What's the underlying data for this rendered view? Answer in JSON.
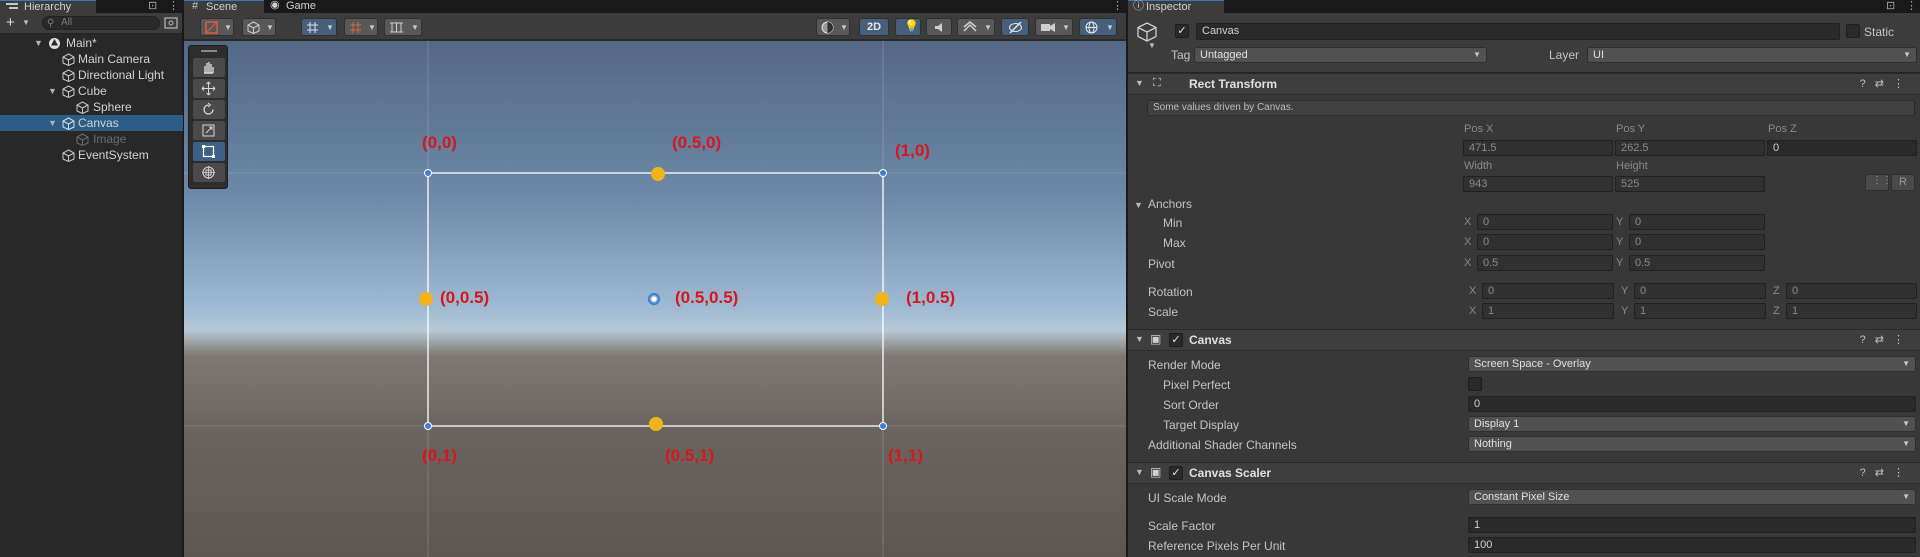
{
  "hierarchy": {
    "tab_label": "Hierarchy",
    "add_label": "+",
    "search_placeholder": "All",
    "items": [
      {
        "label": "Main*",
        "icon": "unity-scene-icon"
      },
      {
        "label": "Main Camera",
        "icon": "cube-icon"
      },
      {
        "label": "Directional Light",
        "icon": "cube-icon"
      },
      {
        "label": "Cube",
        "icon": "cube-icon"
      },
      {
        "label": "Sphere",
        "icon": "cube-icon"
      },
      {
        "label": "Canvas",
        "icon": "cube-icon",
        "selected": true
      },
      {
        "label": "Image",
        "icon": "cube-icon",
        "disabled": true
      },
      {
        "label": "EventSystem",
        "icon": "cube-icon"
      }
    ]
  },
  "scene": {
    "tabs": [
      {
        "label": "Scene",
        "icon": "hash-icon"
      },
      {
        "label": "Game",
        "icon": "gamepad-icon"
      }
    ],
    "toolbar": {
      "mode_2d_label": "2D"
    },
    "tools": [
      "hand-tool",
      "move-tool",
      "rotate-tool",
      "scale-tool",
      "rect-tool",
      "transform-tool"
    ],
    "active_tool": "rect-tool",
    "anchor_labels": {
      "top_left": "(0,0)",
      "top_center": "(0.5,0)",
      "top_right": "(1,0)",
      "middle_left": "(0,0.5)",
      "center": "(0.5,0.5)",
      "middle_right": "(1,0.5)",
      "bottom_left": "(0,1)",
      "bottom_center": "(0.5,1)",
      "bottom_right": "(1,1)"
    },
    "colors": {
      "anchor_label": "#d8161b",
      "handle": "#f2b21b",
      "corner": "#3f7fd6"
    }
  },
  "inspector": {
    "tab_label": "Inspector",
    "object_name": "Canvas",
    "static_label": "Static",
    "tag_label": "Tag",
    "tag_value": "Untagged",
    "layer_label": "Layer",
    "layer_value": "UI",
    "rect_transform": {
      "title": "Rect Transform",
      "hint": "Some values driven by Canvas.",
      "pos_x_label": "Pos X",
      "pos_y_label": "Pos Y",
      "pos_z_label": "Pos Z",
      "pos_x": "471.5",
      "pos_y": "262.5",
      "pos_z": "0",
      "width_label": "Width",
      "height_label": "Height",
      "width": "943",
      "height": "525",
      "r_button": "R",
      "anchors_label": "Anchors",
      "min_label": "Min",
      "max_label": "Max",
      "min_x": "0",
      "min_y": "0",
      "max_x": "0",
      "max_y": "0",
      "pivot_label": "Pivot",
      "pivot_x": "0.5",
      "pivot_y": "0.5",
      "rotation_label": "Rotation",
      "rot_x": "0",
      "rot_y": "0",
      "rot_z": "0",
      "scale_label": "Scale",
      "scale_x": "1",
      "scale_y": "1",
      "scale_z": "1",
      "axis_x": "X",
      "axis_y": "Y",
      "axis_z": "Z"
    },
    "canvas": {
      "title": "Canvas",
      "render_mode_label": "Render Mode",
      "render_mode": "Screen Space - Overlay",
      "pixel_perfect_label": "Pixel Perfect",
      "sort_order_label": "Sort Order",
      "sort_order": "0",
      "target_display_label": "Target Display",
      "target_display": "Display 1",
      "shader_channels_label": "Additional Shader Channels",
      "shader_channels": "Nothing"
    },
    "canvas_scaler": {
      "title": "Canvas Scaler",
      "ui_scale_mode_label": "UI Scale Mode",
      "ui_scale_mode": "Constant Pixel Size",
      "scale_factor_label": "Scale Factor",
      "scale_factor": "1",
      "ref_ppu_label": "Reference Pixels Per Unit",
      "ref_ppu": "100"
    }
  }
}
